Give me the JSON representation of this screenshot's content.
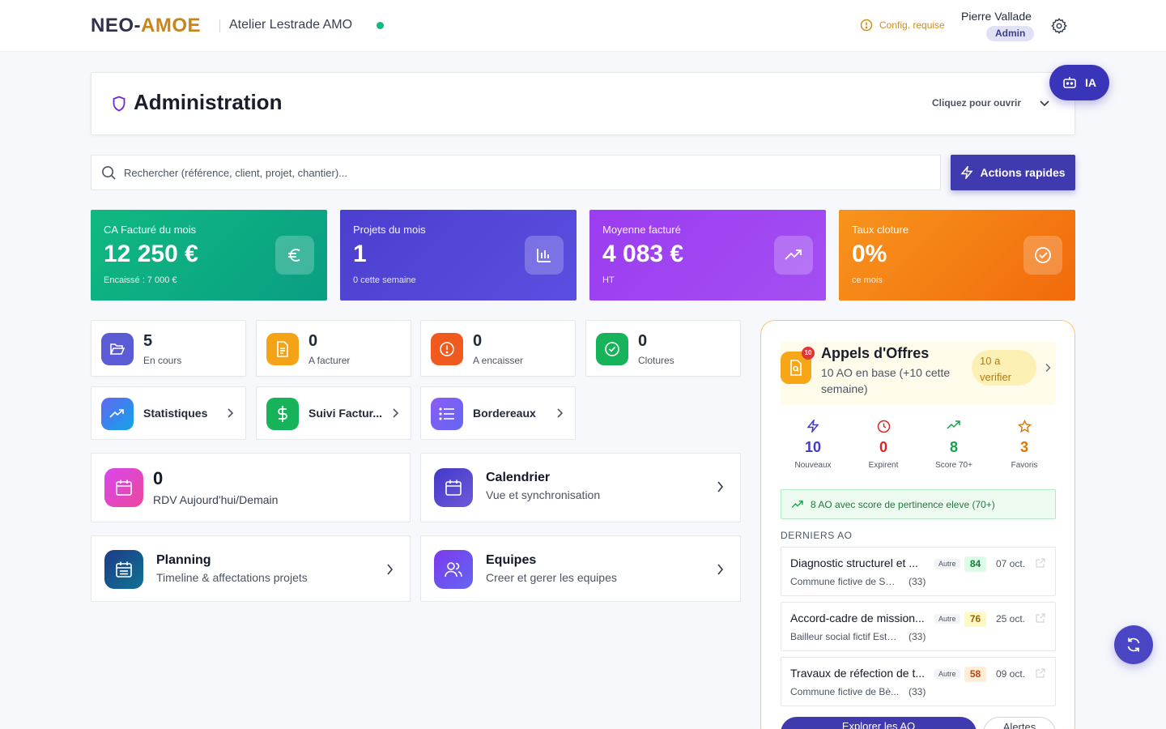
{
  "header": {
    "brand_part1": "NEO-",
    "brand_part2": "AMOE",
    "org_name": "Atelier Lestrade AMO",
    "config_warning": "Config. requise",
    "user_name": "Pierre Vallade",
    "user_role": "Admin"
  },
  "admin": {
    "title": "Administration",
    "hint": "Cliquez pour ouvrir"
  },
  "ia_button": {
    "label": "IA"
  },
  "search": {
    "placeholder": "Rechercher (référence, client, projet, chantier)..."
  },
  "quick_actions": {
    "label": "Actions rapides"
  },
  "kpis": [
    {
      "label": "CA Facturé du mois",
      "value": "12 250 €",
      "sub": "Encaissé : 7 000 €",
      "icon": "euro-icon"
    },
    {
      "label": "Projets du mois",
      "value": "1",
      "sub": "0 cette semaine",
      "icon": "bar-chart-icon"
    },
    {
      "label": "Moyenne facturé",
      "value": "4 083 €",
      "sub": "HT",
      "icon": "trend-up-icon"
    },
    {
      "label": "Taux cloture",
      "value": "0%",
      "sub": "ce mois",
      "icon": "check-circle-icon"
    }
  ],
  "stats": [
    {
      "value": "5",
      "label": "En cours",
      "color": "#5b5bd6"
    },
    {
      "value": "0",
      "label": "A facturer",
      "color": "#f5a316"
    },
    {
      "value": "0",
      "label": "A encaisser",
      "color": "#f05a1e"
    },
    {
      "value": "0",
      "label": "Clotures",
      "color": "#16b35a"
    }
  ],
  "links": [
    {
      "label": "Statistiques"
    },
    {
      "label": "Suivi Factur..."
    },
    {
      "label": "Bordereaux"
    }
  ],
  "rdv": {
    "value": "0",
    "label": "RDV Aujourd'hui/Demain"
  },
  "calendar": {
    "title": "Calendrier",
    "sub": "Vue et synchronisation"
  },
  "planning": {
    "title": "Planning",
    "sub": "Timeline & affectations projets"
  },
  "teams": {
    "title": "Equipes",
    "sub": "Creer et gerer les equipes"
  },
  "tenders": {
    "badge": "10",
    "title": "Appels d'Offres",
    "desc": "10 AO en base (+10 cette semaine)",
    "pill": "10 a verifier",
    "metrics": [
      {
        "value": "10",
        "label": "Nouveaux",
        "color": "#4338ca"
      },
      {
        "value": "0",
        "label": "Expirent",
        "color": "#dc2626"
      },
      {
        "value": "8",
        "label": "Score 70+",
        "color": "#16a34a"
      },
      {
        "value": "3",
        "label": "Favoris",
        "color": "#d97706"
      }
    ],
    "alert": "8 AO avec score de pertinence eleve (70+)",
    "section_title": "DERNIERS AO",
    "items": [
      {
        "title": "Diagnostic structurel et ...",
        "tag": "Autre",
        "score": "84",
        "date": "07 oct.",
        "client": "Commune fictive de Sai...",
        "dept": "(33)"
      },
      {
        "title": "Accord-cadre de mission...",
        "tag": "Autre",
        "score": "76",
        "date": "25 oct.",
        "client": "Bailleur social fictif Este...",
        "dept": "(33)"
      },
      {
        "title": "Travaux de réfection de t...",
        "tag": "Autre",
        "score": "58",
        "date": "09 oct.",
        "client": "Commune fictive de Bè...",
        "dept": "(33)"
      }
    ],
    "explore_label": "Explorer les AO",
    "alerts_label": "Alertes"
  }
}
